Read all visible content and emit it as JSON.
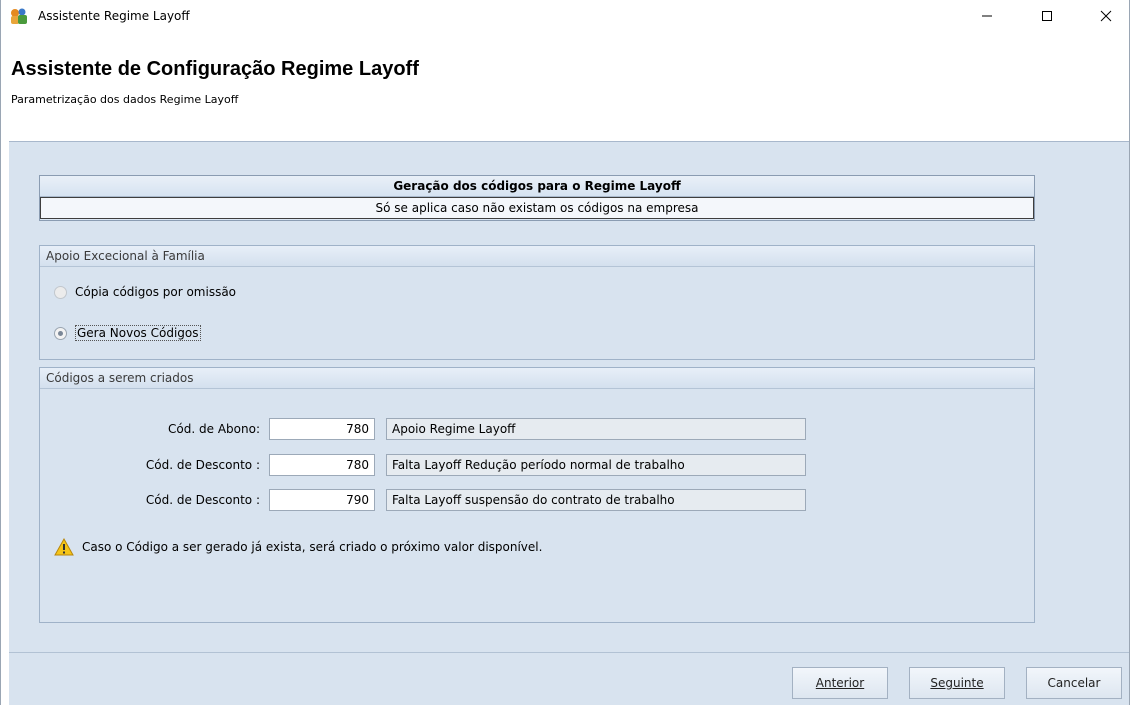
{
  "window": {
    "title": "Assistente Regime Layoff"
  },
  "header": {
    "title": "Assistente de Configuração Regime Layoff",
    "subtitle": "Parametrização dos dados Regime Layoff"
  },
  "section": {
    "title": "Geração dos códigos para o Regime Layoff",
    "note": "Só se aplica caso não existam os códigos na empresa"
  },
  "family_support": {
    "title": "Apoio Excecional à Família",
    "options": [
      {
        "label": "Cópia códigos por omissão",
        "checked": false,
        "enabled": false
      },
      {
        "label": "Gera Novos Códigos",
        "checked": true,
        "enabled": true
      }
    ]
  },
  "codes": {
    "title": "Códigos a serem criados",
    "rows": [
      {
        "label": "Cód. de Abono:",
        "value": "780",
        "description": "Apoio Regime Layoff"
      },
      {
        "label": "Cód. de Desconto :",
        "value": "780",
        "description": "Falta Layoff Redução período normal de trabalho"
      },
      {
        "label": "Cód. de Desconto :",
        "value": "790",
        "description": "Falta Layoff suspensão do contrato de trabalho"
      }
    ],
    "warning": "Caso o Código a ser gerado já exista, será criado o próximo valor disponível."
  },
  "footer": {
    "prev_label": "Anterior",
    "next_label": "Seguinte",
    "cancel_label": "Cancelar"
  },
  "colors": {
    "panel_background": "#d8e3ef",
    "border": "#9fb2c8"
  }
}
